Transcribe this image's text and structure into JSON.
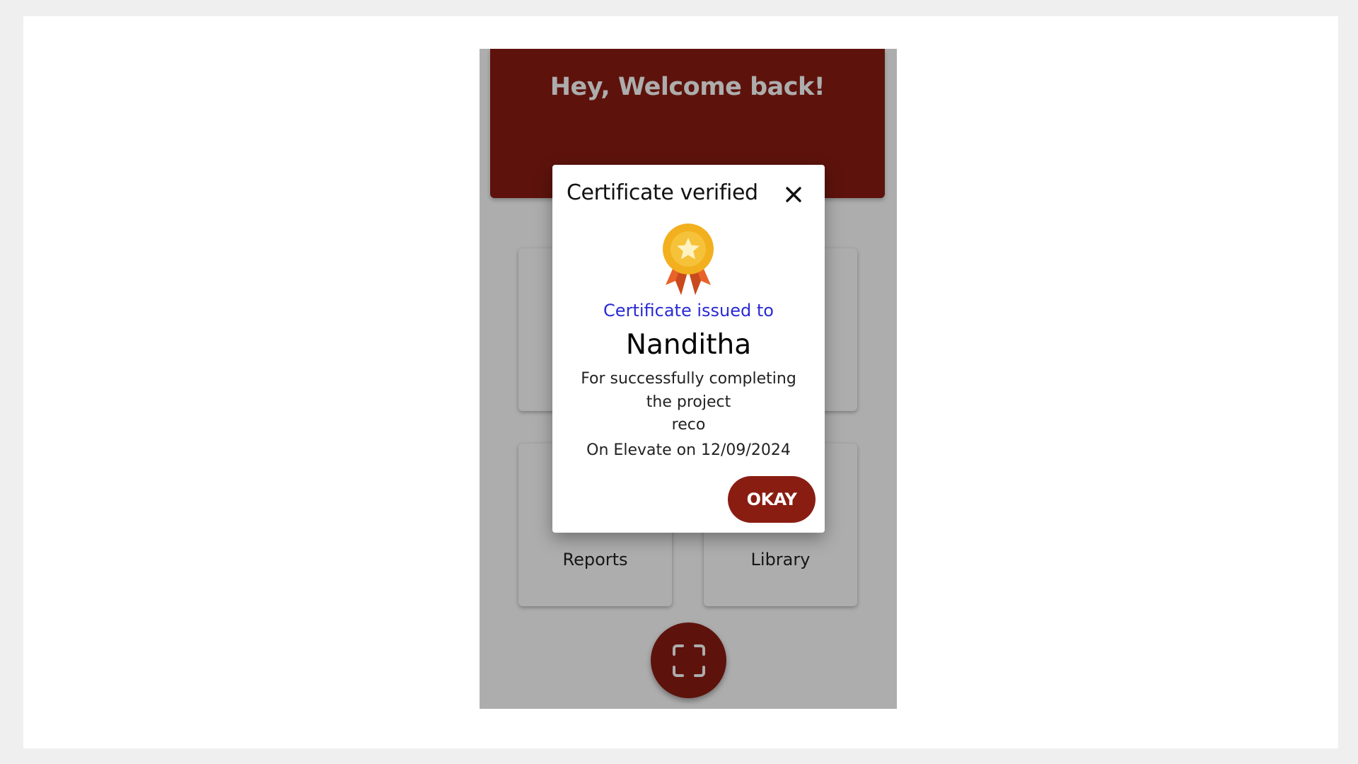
{
  "header": {
    "welcome_text": "Hey, Welcome back!"
  },
  "tiles": [
    {
      "label": ""
    },
    {
      "label": ""
    },
    {
      "label": "Reports"
    },
    {
      "label": "Library"
    }
  ],
  "fab": {
    "icon": "scan-icon"
  },
  "dialog": {
    "title": "Certificate verified",
    "close_icon": "close-icon",
    "badge_icon": "medal-icon",
    "issued_to_label": "Certificate issued to",
    "recipient_name": "Nanditha",
    "description": "For successfully completing the project",
    "project_name": "reco",
    "issued_on": "On Elevate on 12/09/2024",
    "okay_label": "OKAY"
  },
  "colors": {
    "brand": "#8a1d12",
    "link_blue": "#2a2ad6",
    "medal_gold": "#f2b01e",
    "ribbon_orange": "#e8622a"
  }
}
